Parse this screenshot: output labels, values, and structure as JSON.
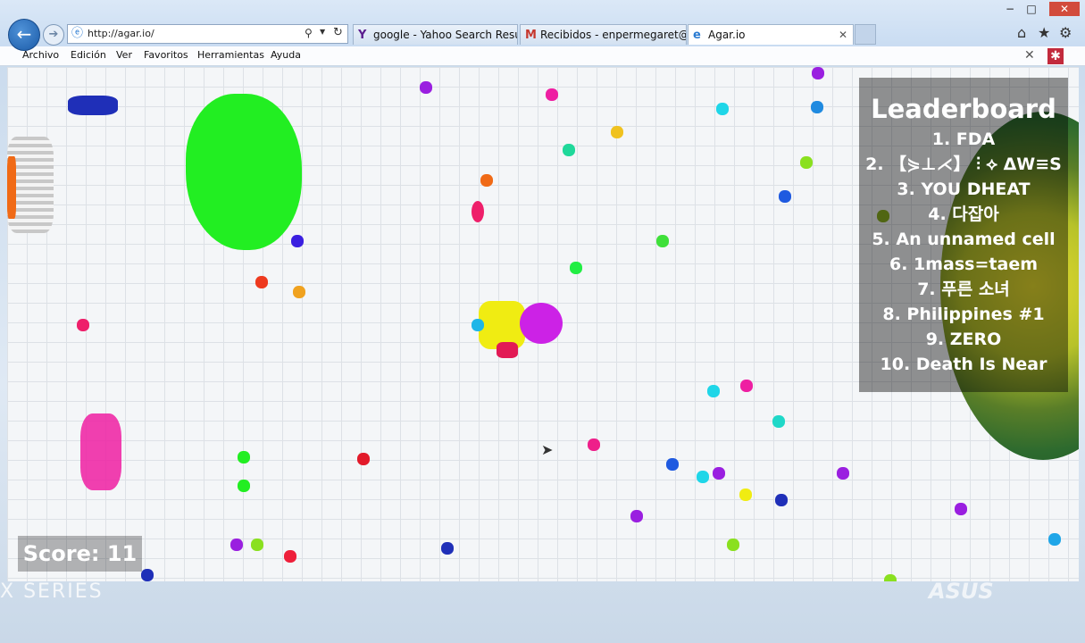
{
  "browser": {
    "url": "http://agar.io/",
    "tabs": [
      {
        "label": "google - Yahoo Search Results",
        "icon": "Y"
      },
      {
        "label": "Recibidos - enpermegaret@g...",
        "icon": "M"
      },
      {
        "label": "Agar.io",
        "icon": "e"
      }
    ],
    "menu": [
      "Archivo",
      "Edición",
      "Ver",
      "Favoritos",
      "Herramientas",
      "Ayuda"
    ],
    "window_controls": [
      "−",
      "□",
      "✕"
    ]
  },
  "game": {
    "leaderboard_title": "Leaderboard",
    "leaderboard": [
      "1. FDA",
      "2. 【⋟⊥⋌】 ⫶ ⟡ ΔW≡S",
      "3. YOU DHEAT",
      "4. 다잡아",
      "5. An unnamed cell",
      "6. 1mass=taem",
      "7. 푸른 소녀",
      "8. Philippines #1",
      "9. ZERO",
      "10. Death Is Near"
    ],
    "score_text": "Score: 11"
  },
  "colors": {
    "player_cell": "#cc22e6",
    "green_cell": "#22ee22",
    "yellow_cell": "#f0ec12",
    "leaderboard_bg": "rgba(0,0,0,0.42)"
  },
  "desktop": {
    "left_text": "X SERIES",
    "right_text": "ASUS"
  }
}
